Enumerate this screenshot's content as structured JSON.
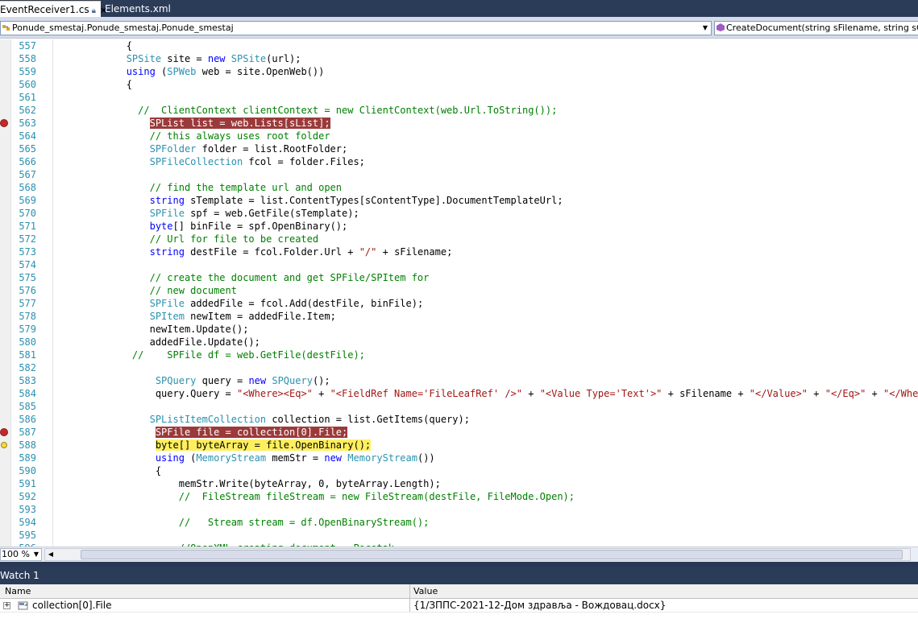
{
  "tabs": [
    {
      "label": "EventReceiver1.cs",
      "active": true
    },
    {
      "label": "Elements.xml",
      "active": false
    }
  ],
  "navbar": {
    "type_combo": "Ponude_smestaj.Ponude_smestaj.Ponude_smestaj",
    "member_combo": "CreateDocument(string sFilename, string sContentType, string sList)"
  },
  "editor": {
    "zoom": "100 %",
    "lines": [
      {
        "n": "557",
        "tokens": [
          [
            "",
            "            {"
          ]
        ]
      },
      {
        "n": "558",
        "tokens": [
          [
            "",
            "            "
          ],
          [
            "ty",
            "SPSite"
          ],
          [
            "",
            " site = "
          ],
          [
            "kw",
            "new"
          ],
          [
            "",
            " "
          ],
          [
            "ty",
            "SPSite"
          ],
          [
            "",
            "(url);"
          ]
        ]
      },
      {
        "n": "559",
        "tokens": [
          [
            "",
            "            "
          ],
          [
            "kw",
            "using"
          ],
          [
            "",
            " ("
          ],
          [
            "ty",
            "SPWeb"
          ],
          [
            "",
            " web = site.OpenWeb())"
          ]
        ]
      },
      {
        "n": "560",
        "tokens": [
          [
            "",
            "            {"
          ]
        ]
      },
      {
        "n": "561",
        "tokens": [
          [
            "",
            ""
          ]
        ]
      },
      {
        "n": "562",
        "tokens": [
          [
            "",
            "              "
          ],
          [
            "cm",
            "//  ClientContext clientContext = new ClientContext(web.Url.ToString());"
          ]
        ]
      },
      {
        "n": "563",
        "marker": "breakpoint",
        "hl": "hlbp",
        "pre": "                ",
        "tokens": [
          [
            "",
            "SPList list = web.Lists[sList];"
          ]
        ]
      },
      {
        "n": "564",
        "tokens": [
          [
            "",
            "                "
          ],
          [
            "cm",
            "// this always uses root folder"
          ]
        ]
      },
      {
        "n": "565",
        "tokens": [
          [
            "",
            "                "
          ],
          [
            "ty",
            "SPFolder"
          ],
          [
            "",
            " folder = list.RootFolder;"
          ]
        ]
      },
      {
        "n": "566",
        "tokens": [
          [
            "",
            "                "
          ],
          [
            "ty",
            "SPFileCollection"
          ],
          [
            "",
            " fcol = folder.Files;"
          ]
        ]
      },
      {
        "n": "567",
        "tokens": [
          [
            "",
            ""
          ]
        ]
      },
      {
        "n": "568",
        "tokens": [
          [
            "",
            "                "
          ],
          [
            "cm",
            "// find the template url and open"
          ]
        ]
      },
      {
        "n": "569",
        "tokens": [
          [
            "",
            "                "
          ],
          [
            "kw",
            "string"
          ],
          [
            "",
            " sTemplate = list.ContentTypes[sContentType].DocumentTemplateUrl;"
          ]
        ]
      },
      {
        "n": "570",
        "tokens": [
          [
            "",
            "                "
          ],
          [
            "ty",
            "SPFile"
          ],
          [
            "",
            " spf = web.GetFile(sTemplate);"
          ]
        ]
      },
      {
        "n": "571",
        "tokens": [
          [
            "",
            "                "
          ],
          [
            "kw",
            "byte"
          ],
          [
            "",
            "[] binFile = spf.OpenBinary();"
          ]
        ]
      },
      {
        "n": "572",
        "tokens": [
          [
            "",
            "                "
          ],
          [
            "cm",
            "// Url for file to be created"
          ]
        ]
      },
      {
        "n": "573",
        "tokens": [
          [
            "",
            "                "
          ],
          [
            "kw",
            "string"
          ],
          [
            "",
            " destFile = fcol.Folder.Url + "
          ],
          [
            "st",
            "\"/\""
          ],
          [
            "",
            " + sFilename;"
          ]
        ]
      },
      {
        "n": "574",
        "tokens": [
          [
            "",
            ""
          ]
        ]
      },
      {
        "n": "575",
        "tokens": [
          [
            "",
            "                "
          ],
          [
            "cm",
            "// create the document and get SPFile/SPItem for"
          ]
        ]
      },
      {
        "n": "576",
        "tokens": [
          [
            "",
            "                "
          ],
          [
            "cm",
            "// new document"
          ]
        ]
      },
      {
        "n": "577",
        "tokens": [
          [
            "",
            "                "
          ],
          [
            "ty",
            "SPFile"
          ],
          [
            "",
            " addedFile = fcol.Add(destFile, binFile);"
          ]
        ]
      },
      {
        "n": "578",
        "tokens": [
          [
            "",
            "                "
          ],
          [
            "ty",
            "SPItem"
          ],
          [
            "",
            " newItem = addedFile.Item;"
          ]
        ]
      },
      {
        "n": "579",
        "tokens": [
          [
            "",
            "                newItem.Update();"
          ]
        ]
      },
      {
        "n": "580",
        "tokens": [
          [
            "",
            "                addedFile.Update();"
          ]
        ]
      },
      {
        "n": "581",
        "tokens": [
          [
            "",
            "             "
          ],
          [
            "cm",
            "//    SPFile df = web.GetFile(destFile);"
          ]
        ]
      },
      {
        "n": "582",
        "tokens": [
          [
            "",
            ""
          ]
        ]
      },
      {
        "n": "583",
        "tokens": [
          [
            "",
            "                 "
          ],
          [
            "ty",
            "SPQuery"
          ],
          [
            "",
            " query = "
          ],
          [
            "kw",
            "new"
          ],
          [
            "",
            " "
          ],
          [
            "ty",
            "SPQuery"
          ],
          [
            "",
            "();"
          ]
        ]
      },
      {
        "n": "584",
        "tokens": [
          [
            "",
            "                 query.Query = "
          ],
          [
            "st",
            "\"<Where><Eq>\""
          ],
          [
            "",
            " + "
          ],
          [
            "st",
            "\"<FieldRef Name='FileLeafRef' />\""
          ],
          [
            "",
            " + "
          ],
          [
            "st",
            "\"<Value Type='Text'>\""
          ],
          [
            "",
            " + sFilename + "
          ],
          [
            "st",
            "\"</Value>\""
          ],
          [
            "",
            " + "
          ],
          [
            "st",
            "\"</Eq>\""
          ],
          [
            "",
            " + "
          ],
          [
            "st",
            "\"</Where>\""
          ],
          [
            "",
            ";"
          ]
        ]
      },
      {
        "n": "585",
        "tokens": [
          [
            "",
            ""
          ]
        ]
      },
      {
        "n": "586",
        "tokens": [
          [
            "",
            "                "
          ],
          [
            "ty",
            "SPListItemCollection"
          ],
          [
            "",
            " collection = list.GetItems(query);"
          ]
        ]
      },
      {
        "n": "587",
        "marker": "breakpoint",
        "hl": "hlbp",
        "pre": "                 ",
        "tokens": [
          [
            "",
            "SPFile file = collection[0].File;"
          ]
        ]
      },
      {
        "n": "588",
        "marker": "current",
        "hl": "hlcur",
        "pre": "                 ",
        "tokens": [
          [
            "",
            "byte[] byteArray = file.OpenBinary();"
          ]
        ]
      },
      {
        "n": "589",
        "tokens": [
          [
            "",
            "                 "
          ],
          [
            "kw",
            "using"
          ],
          [
            "",
            " ("
          ],
          [
            "ty",
            "MemoryStream"
          ],
          [
            "",
            " memStr = "
          ],
          [
            "kw",
            "new"
          ],
          [
            "",
            " "
          ],
          [
            "ty",
            "MemoryStream"
          ],
          [
            "",
            "())"
          ]
        ]
      },
      {
        "n": "590",
        "tokens": [
          [
            "",
            "                 {"
          ]
        ]
      },
      {
        "n": "591",
        "tokens": [
          [
            "",
            "                     memStr.Write(byteArray, 0, byteArray.Length);"
          ]
        ]
      },
      {
        "n": "592",
        "tokens": [
          [
            "",
            "                     "
          ],
          [
            "cm",
            "//  FileStream fileStream = new FileStream(destFile, FileMode.Open);"
          ]
        ]
      },
      {
        "n": "593",
        "tokens": [
          [
            "",
            ""
          ]
        ]
      },
      {
        "n": "594",
        "tokens": [
          [
            "",
            "                     "
          ],
          [
            "cm",
            "//   Stream stream = df.OpenBinaryStream();"
          ]
        ]
      },
      {
        "n": "595",
        "tokens": [
          [
            "",
            ""
          ]
        ]
      },
      {
        "n": "596",
        "tokens": [
          [
            "",
            "                     "
          ],
          [
            "cm",
            "//OpenXML creating document - Pocetak"
          ]
        ]
      }
    ]
  },
  "watch": {
    "title": "Watch 1",
    "col_name": "Name",
    "col_value": "Value",
    "rows": [
      {
        "name": "collection[0].File",
        "value": "{1/ЗППС-2021-12-Дом здравља - Вождовац.docx}"
      }
    ]
  },
  "colors": {
    "keyword": "#0000ff",
    "type": "#2b91af",
    "comment": "#008000",
    "string": "#a31515",
    "breakpoint_highlight": "#9b3a3a",
    "current_line_highlight": "#ffef5f"
  },
  "icons": {
    "tab_pin": "pin-icon",
    "tab_close": "close-icon",
    "breakpoint": "breakpoint-icon",
    "current_statement": "current-statement-arrow-icon",
    "expander": "plus-expand-icon",
    "property": "property-icon"
  }
}
